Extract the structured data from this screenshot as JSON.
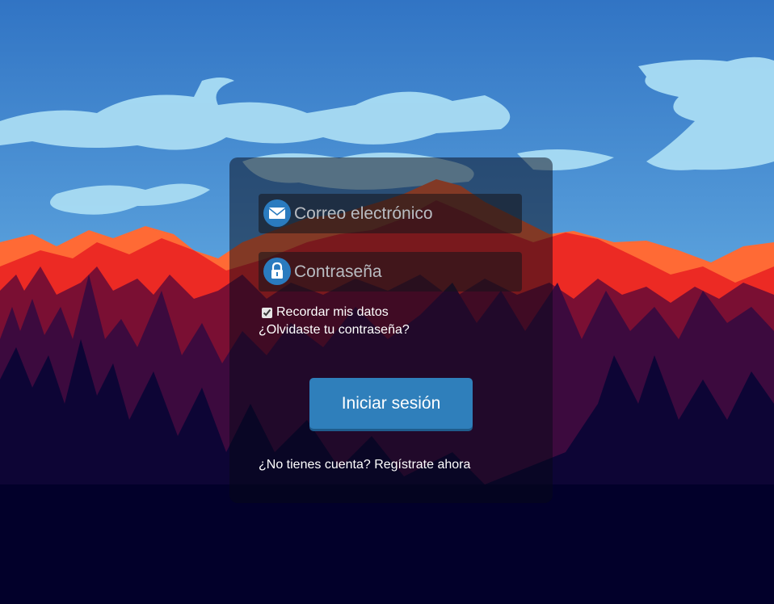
{
  "background": {
    "description_icon": "mountain-forest-landscape"
  },
  "login": {
    "email_placeholder": "Correo electrónico",
    "password_placeholder": "Contraseña",
    "remember_label": "Recordar mis datos",
    "remember_checked": true,
    "forgot_link": "¿Olvidaste tu contraseña?",
    "submit_label": "Iniciar sesión",
    "register_link": "¿No tienes cuenta? Regístrate ahora",
    "email_icon": "envelope-icon",
    "password_icon": "lock-icon"
  },
  "colors": {
    "accent": "#2f7fbb",
    "icon_circle": "#2a7bbf",
    "sky_top": "#3174c4",
    "mountain_orange": "#ff5d2e",
    "mountain_red": "#ee2b24",
    "forest_dark": "#02002a"
  }
}
